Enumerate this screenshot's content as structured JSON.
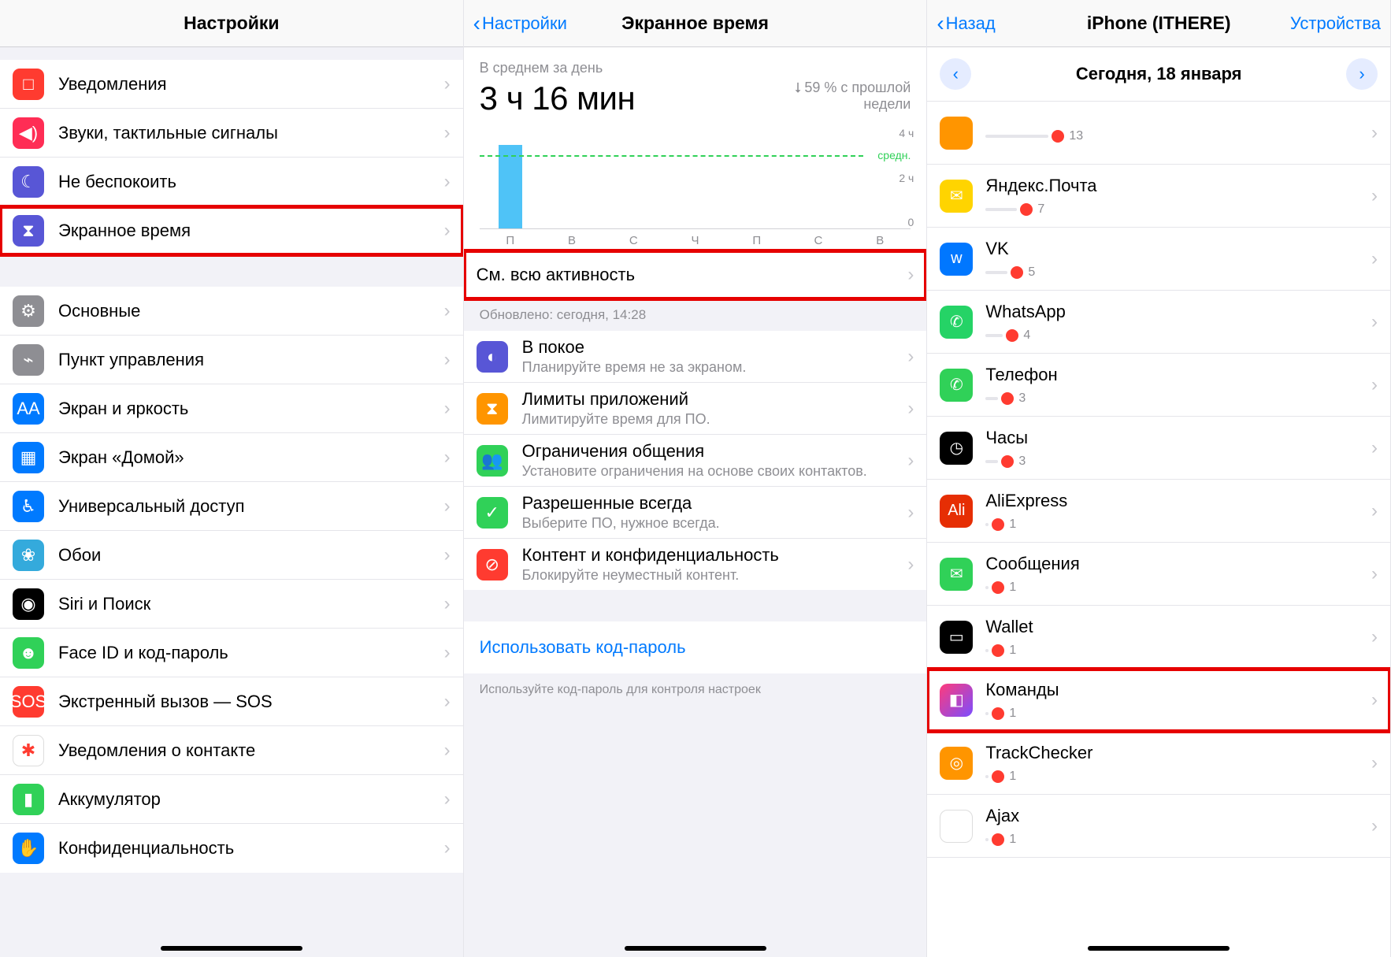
{
  "panel1": {
    "title": "Настройки",
    "group1": [
      {
        "label": "Уведомления",
        "icon": "□",
        "bg": "bg-red",
        "name": "notifications"
      },
      {
        "label": "Звуки, тактильные сигналы",
        "icon": "◀︎)",
        "bg": "bg-pink",
        "name": "sounds"
      },
      {
        "label": "Не беспокоить",
        "icon": "☾",
        "bg": "bg-purple",
        "name": "dnd"
      },
      {
        "label": "Экранное время",
        "icon": "⧗",
        "bg": "bg-purple",
        "name": "screen-time",
        "highlight": true
      }
    ],
    "group2": [
      {
        "label": "Основные",
        "icon": "⚙︎",
        "bg": "bg-grey",
        "name": "general"
      },
      {
        "label": "Пункт управления",
        "icon": "⌁",
        "bg": "bg-grey",
        "name": "control-center"
      },
      {
        "label": "Экран и яркость",
        "icon": "AA",
        "bg": "bg-blue",
        "name": "display"
      },
      {
        "label": "Экран «Домой»",
        "icon": "▦",
        "bg": "bg-blue",
        "name": "home-screen"
      },
      {
        "label": "Универсальный доступ",
        "icon": "♿︎",
        "bg": "bg-blue",
        "name": "accessibility"
      },
      {
        "label": "Обои",
        "icon": "❀",
        "bg": "bg-blue2",
        "name": "wallpaper"
      },
      {
        "label": "Siri и Поиск",
        "icon": "◉",
        "bg": "bg-black",
        "name": "siri"
      },
      {
        "label": "Face ID и код-пароль",
        "icon": "☻",
        "bg": "bg-green",
        "name": "faceid"
      },
      {
        "label": "Экстренный вызов — SOS",
        "icon": "SOS",
        "bg": "bg-red",
        "name": "sos"
      },
      {
        "label": "Уведомления о контакте",
        "icon": "✱",
        "bg": "bg-white",
        "name": "exposure",
        "iconColor": "#ff3b30"
      },
      {
        "label": "Аккумулятор",
        "icon": "▮",
        "bg": "bg-green",
        "name": "battery"
      },
      {
        "label": "Конфиденциальность",
        "icon": "✋",
        "bg": "bg-blue",
        "name": "privacy"
      }
    ]
  },
  "panel2": {
    "back": "Настройки",
    "title": "Экранное время",
    "avg_label": "В среднем за день",
    "big_time": "3 ч 16 мин",
    "pct_text": "59 % с прошлой недели",
    "y_top": "4 ч",
    "y_mid": "2 ч",
    "y_bot": "0",
    "avg_tag": "средн.",
    "days": [
      "П",
      "В",
      "С",
      "Ч",
      "П",
      "С",
      "В"
    ],
    "activity_label": "См. всю активность",
    "updated": "Обновлено: сегодня, 14:28",
    "options": [
      {
        "title": "В покое",
        "sub": "Планируйте время не за экраном.",
        "icon": "◐",
        "bg": "bg-purple",
        "name": "downtime"
      },
      {
        "title": "Лимиты приложений",
        "sub": "Лимитируйте время для ПО.",
        "icon": "⧗",
        "bg": "bg-orange",
        "name": "app-limits"
      },
      {
        "title": "Ограничения общения",
        "sub": "Установите ограничения на основе своих контактов.",
        "icon": "👥",
        "bg": "bg-green",
        "name": "comm-limits"
      },
      {
        "title": "Разрешенные всегда",
        "sub": "Выберите ПО, нужное всегда.",
        "icon": "✓",
        "bg": "bg-green",
        "name": "always-allowed"
      },
      {
        "title": "Контент и конфиденциальность",
        "sub": "Блокируйте неуместный контент.",
        "icon": "⊘",
        "bg": "bg-red",
        "name": "content-privacy"
      }
    ],
    "passcode_link": "Использовать код-пароль",
    "footer_hint": "Используйте код-пароль для контроля настроек"
  },
  "panel3": {
    "back": "Назад",
    "title": "iPhone (ITHERE)",
    "right": "Устройства",
    "date": "Сегодня, 18 января",
    "apps": [
      {
        "name": "",
        "count": "13",
        "bg": "bg-orange",
        "track": 80,
        "partial": true
      },
      {
        "name": "Яндекс.Почта",
        "count": "7",
        "bg": "bg-yellow",
        "icon": "✉",
        "track": 40
      },
      {
        "name": "VK",
        "count": "5",
        "bg": "bg-vk",
        "icon": "w",
        "track": 28
      },
      {
        "name": "WhatsApp",
        "count": "4",
        "bg": "bg-wa",
        "icon": "✆",
        "track": 22
      },
      {
        "name": "Телефон",
        "count": "3",
        "bg": "bg-green",
        "icon": "✆",
        "track": 16
      },
      {
        "name": "Часы",
        "count": "3",
        "bg": "bg-black",
        "icon": "◷",
        "track": 16
      },
      {
        "name": "AliExpress",
        "count": "1",
        "bg": "bg-ali",
        "icon": "Ali",
        "track": 4
      },
      {
        "name": "Сообщения",
        "count": "1",
        "bg": "bg-green",
        "icon": "✉",
        "track": 4
      },
      {
        "name": "Wallet",
        "count": "1",
        "bg": "bg-wallet",
        "icon": "▭",
        "track": 4
      },
      {
        "name": "Команды",
        "count": "1",
        "bg": "bg-shortcuts",
        "icon": "◧",
        "track": 4,
        "highlight": true
      },
      {
        "name": "TrackChecker",
        "count": "1",
        "bg": "bg-orange",
        "icon": "◎",
        "track": 4
      },
      {
        "name": "Ajax",
        "count": "1",
        "bg": "bg-white",
        "icon": "▼",
        "track": 4
      }
    ]
  },
  "chart_data": {
    "type": "bar",
    "title": "В среднем за день",
    "categories": [
      "П",
      "В",
      "С",
      "Ч",
      "П",
      "С",
      "В"
    ],
    "values": [
      3.27,
      0,
      0,
      0,
      0,
      0,
      0
    ],
    "average_line": 3.27,
    "ylim": [
      0,
      4
    ],
    "ylabel": "ч",
    "xlabel": "",
    "annotations": {
      "pct_change": "59 % с прошлой недели",
      "direction": "down"
    }
  }
}
